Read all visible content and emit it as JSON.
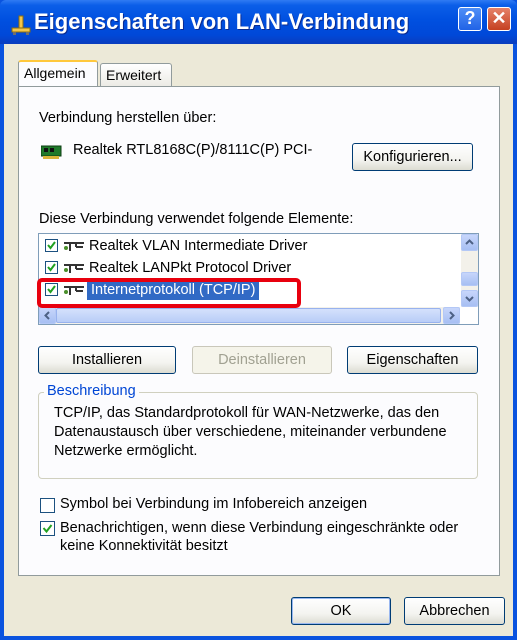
{
  "window": {
    "title": "Eigenschaften von LAN-Verbindung",
    "help_button": "?",
    "close_button": "✕"
  },
  "tabs": [
    {
      "label": "Allgemein",
      "active": true
    },
    {
      "label": "Erweitert",
      "active": false
    }
  ],
  "connection": {
    "label": "Verbindung herstellen über:",
    "adapter": "Realtek RTL8168C(P)/8111C(P) PCI-",
    "configure_button": "Konfigurieren..."
  },
  "components": {
    "label": "Diese Verbindung verwendet folgende Elemente:",
    "items": [
      {
        "label": "Realtek VLAN Intermediate Driver",
        "checked": true,
        "selected": false
      },
      {
        "label": "Realtek LANPkt Protocol Driver",
        "checked": true,
        "selected": false
      },
      {
        "label": "Internetprotokoll (TCP/IP)",
        "checked": true,
        "selected": true
      }
    ]
  },
  "buttons": {
    "install": "Installieren",
    "uninstall": "Deinstallieren",
    "properties": "Eigenschaften"
  },
  "description": {
    "title": "Beschreibung",
    "text": "TCP/IP, das Standardprotokoll für WAN-Netzwerke, das den Datenaustausch über verschiedene, miteinander verbundene Netzwerke ermöglicht."
  },
  "options": {
    "show_icon": {
      "label": "Symbol bei Verbindung im Infobereich anzeigen",
      "checked": false
    },
    "notify": {
      "label": "Benachrichtigen, wenn diese Verbindung eingeschränkte oder keine Konnektivität besitzt",
      "checked": true
    }
  },
  "dialog_buttons": {
    "ok": "OK",
    "cancel": "Abbrechen"
  },
  "colors": {
    "title_bar": "#0050e0",
    "selection": "#316ac5",
    "highlight_box": "#e8000e",
    "group_title": "#0046d5"
  }
}
